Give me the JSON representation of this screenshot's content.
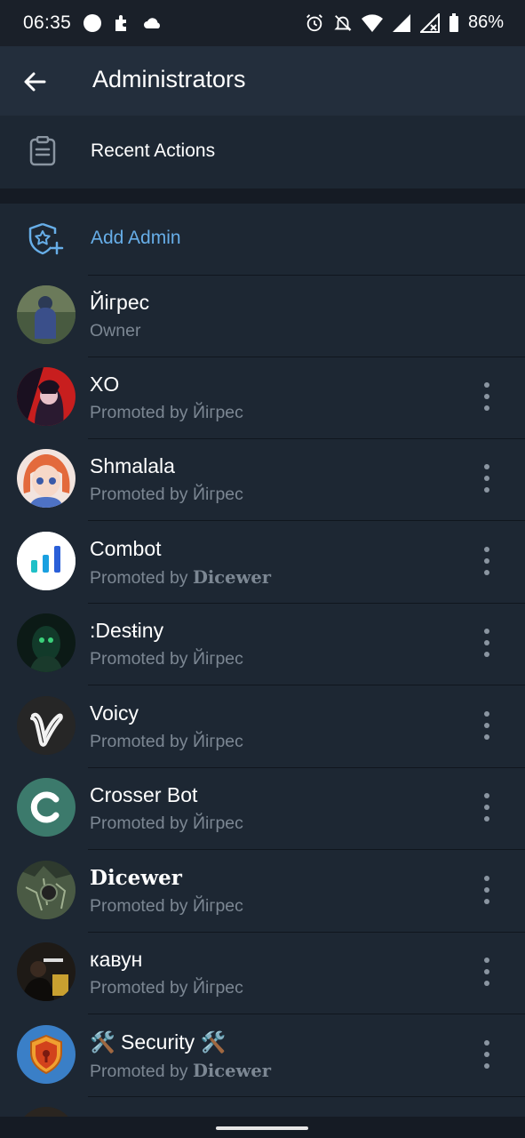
{
  "status_bar": {
    "time": "06:35",
    "battery": "86%"
  },
  "app_bar": {
    "title": "Administrators",
    "back_icon": "arrow-left-icon"
  },
  "recent_actions": {
    "label": "Recent Actions",
    "icon": "clipboard-icon"
  },
  "add_admin": {
    "label": "Add Admin",
    "icon": "shield-star-plus-icon"
  },
  "admins": [
    {
      "name": "Йігрес",
      "role": "Owner",
      "promoted_by": "",
      "avatar_bg": "#3a4a3a",
      "avatar_style": "photo-person"
    },
    {
      "name": "XO",
      "role": "Promoted by ",
      "promoted_by": "Йігрес",
      "avatar_bg": "#d32626",
      "avatar_style": "anime-dark"
    },
    {
      "name": "Shmalala",
      "role": "Promoted by ",
      "promoted_by": "Йігрес",
      "avatar_bg": "#e8d6d0",
      "avatar_style": "anime-girl"
    },
    {
      "name": "Combot",
      "role": "Promoted by ",
      "promoted_by": "Dicewer",
      "avatar_bg": "#ffffff",
      "avatar_style": "bar-chart"
    },
    {
      "name": ":Desŧiny",
      "role": "Promoted by ",
      "promoted_by": "Йігрес",
      "avatar_bg": "#0f1f1a",
      "avatar_style": "dark-green"
    },
    {
      "name": "Voicy",
      "role": "Promoted by ",
      "promoted_by": "Йігрес",
      "avatar_bg": "#2a2a2a",
      "avatar_style": "letter-v"
    },
    {
      "name": "Crosser Bot",
      "role": "Promoted by ",
      "promoted_by": "Йігрес",
      "avatar_bg": "#3d7a6b",
      "avatar_style": "letter-c"
    },
    {
      "name": "Dicewer",
      "role": "Promoted by ",
      "promoted_by": "Йігрес",
      "avatar_bg": "#3a4a3a",
      "avatar_style": "dark-art"
    },
    {
      "name": "кавун",
      "role": "Promoted by ",
      "promoted_by": "Йігрес",
      "avatar_bg": "#2a2520",
      "avatar_style": "photo-dark"
    },
    {
      "name": "🛠️ Security 🛠️",
      "role": "Promoted by ",
      "promoted_by": "Dicewer",
      "avatar_bg": "#3a7fc7",
      "avatar_style": "shield"
    }
  ],
  "colors": {
    "background": "#1d2733",
    "accent": "#67aee8",
    "secondary_text": "#7c8793",
    "app_bar": "#232e3c"
  }
}
